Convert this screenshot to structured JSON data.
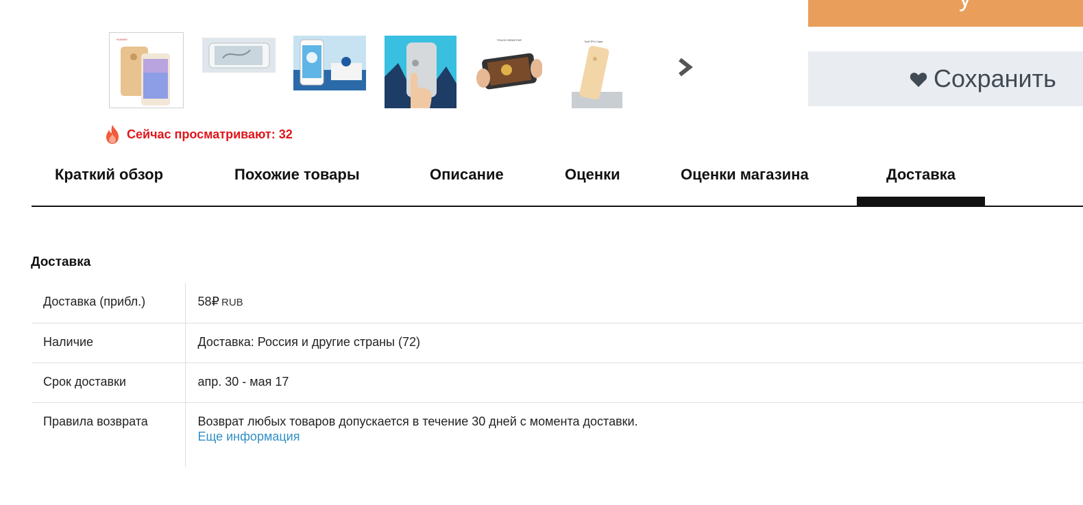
{
  "actions": {
    "buy_label": "у",
    "save_label": "Сохранить",
    "save_icon": "heart-icon"
  },
  "gallery": {
    "thumbnails": [
      {
        "id": "thumb-1",
        "brand_text": "HUAWEI",
        "caption": ""
      },
      {
        "id": "thumb-2",
        "caption": ""
      },
      {
        "id": "thumb-3",
        "caption": ""
      },
      {
        "id": "thumb-4",
        "caption": ""
      },
      {
        "id": "thumb-5",
        "caption": "TOUCH SENSITIVE"
      },
      {
        "id": "thumb-6",
        "caption": "Soft TPU Case"
      }
    ],
    "next_icon": "chevron-right-icon"
  },
  "viewers": {
    "icon": "fire-icon",
    "text": "Сейчас просматривают: 32",
    "color": "#e0151a"
  },
  "tabs": [
    {
      "label": "Краткий обзор",
      "active": false
    },
    {
      "label": "Похожие товары",
      "active": false
    },
    {
      "label": "Описание",
      "active": false
    },
    {
      "label": "Оценки",
      "active": false
    },
    {
      "label": "Оценки магазина",
      "active": false
    },
    {
      "label": "Доставка",
      "active": true
    }
  ],
  "shipping": {
    "title": "Доставка",
    "rows": [
      {
        "label": "Доставка (прибл.)",
        "value": "58₽",
        "currency": "RUB"
      },
      {
        "label": "Наличие",
        "value": "Доставка: Россия и другие страны (72)"
      },
      {
        "label": "Срок доставки",
        "value": "апр. 30 - мая 17"
      },
      {
        "label": "Правила возврата",
        "value": "Возврат любых товаров допускается в течение 30 дней с момента доставки.",
        "link": "Еще информация"
      }
    ]
  },
  "colors": {
    "buy_button": "#e99f5b",
    "save_button": "#e9ecf0",
    "link": "#2f8fc4"
  }
}
